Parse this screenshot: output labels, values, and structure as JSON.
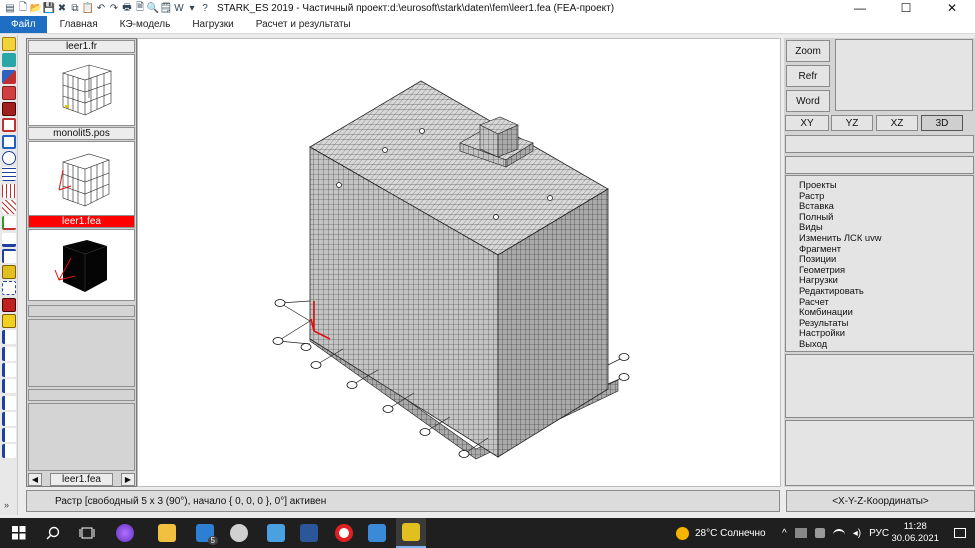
{
  "window": {
    "title": "STARK_ES 2019 - Частичный проект:d:\\eurosoft\\stark\\daten\\fem\\leer1.fea  (FEA-проект)",
    "minimize_glyph": "—",
    "maximize_glyph": "☐",
    "close_glyph": "✕"
  },
  "quick_access": [
    {
      "name": "app-icon",
      "glyph": "▤"
    },
    {
      "name": "new-file-icon",
      "glyph": "🗋"
    },
    {
      "name": "open-folder-icon",
      "glyph": "📂"
    },
    {
      "name": "save-icon",
      "glyph": "💾"
    },
    {
      "name": "close-doc-icon",
      "glyph": "✖"
    },
    {
      "name": "copy-icon",
      "glyph": "⧉"
    },
    {
      "name": "paste-icon",
      "glyph": "📋"
    },
    {
      "name": "undo-icon",
      "glyph": "↶"
    },
    {
      "name": "redo-icon",
      "glyph": "↷"
    },
    {
      "name": "print-icon",
      "glyph": "🖶"
    },
    {
      "name": "print-preview-icon",
      "glyph": "🗎"
    },
    {
      "name": "zoom-icon",
      "glyph": "🔍"
    },
    {
      "name": "note-icon",
      "glyph": "🗒"
    },
    {
      "name": "word-icon",
      "glyph": "W"
    },
    {
      "name": "dropdown-icon",
      "glyph": "▾"
    },
    {
      "name": "help-icon",
      "glyph": "?"
    }
  ],
  "ribbon": {
    "tabs": [
      "Файл",
      "Главная",
      "КЭ-модель",
      "Нагрузки",
      "Расчет и результаты"
    ]
  },
  "thumbnails": {
    "items": [
      {
        "title": "leer1.fr",
        "active": false
      },
      {
        "title": "monolit5.pos",
        "active": false
      },
      {
        "title": "leer1.fea",
        "active": true
      }
    ],
    "nav_prev": "◀",
    "nav_next": "▶",
    "nav_label": "leer1.fea"
  },
  "right_panel": {
    "buttons": [
      "Zoom",
      "Refr",
      "Word"
    ],
    "views": [
      "XY",
      "YZ",
      "XZ",
      "3D"
    ],
    "active_view": "3D",
    "menu": [
      "Проекты",
      "Растр",
      "Вставка",
      "Полный",
      "Виды",
      "Изменить ЛСК uvw",
      "Фрагмент",
      "Позиции",
      "Геометрия",
      "Нагрузки",
      "Редактировать",
      "Расчет",
      "Комбинации",
      "Результаты",
      "Настройки",
      "Выход"
    ]
  },
  "status": {
    "text": "Растр [свободный 5 x 3 (90°), начало { 0, 0, 0 }, 0°] активен",
    "coords": "<X-Y-Z-Координаты>",
    "corner": "»"
  },
  "taskbar": {
    "mail_badge": "5",
    "weather": "28°C  Солнечно",
    "lang": "РУС",
    "time": "11:28",
    "date": "30.06.2021"
  },
  "colors": {
    "ribbon_file_bg": "#1e6fc4",
    "active_thumb": "#ff0000",
    "mesh_face": "#5a5a5a",
    "taskbar": "#1f1f1f"
  }
}
